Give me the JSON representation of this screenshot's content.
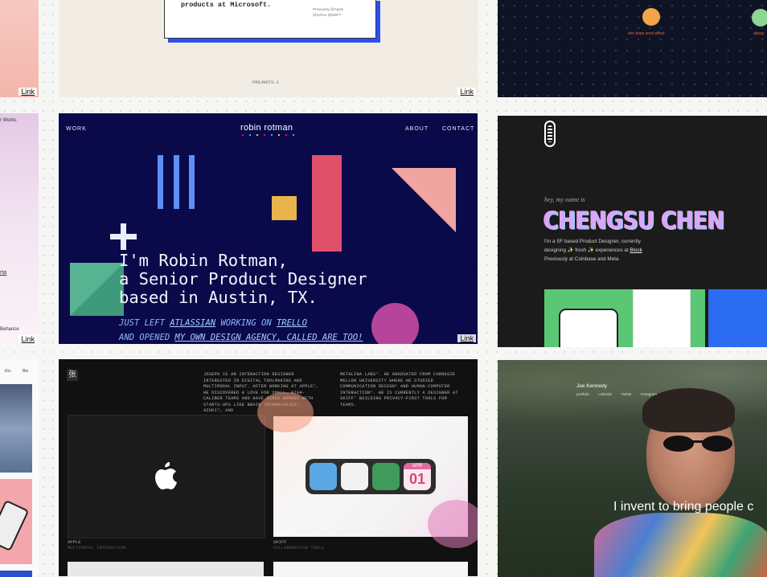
{
  "link_label": "Link",
  "top_middle": {
    "text": "products at Microsoft.",
    "meta_1": "Previously @Apple",
    "meta_2": "@Schoo @MSFT",
    "footer": "PROJNOTS-1"
  },
  "top_right": {
    "caption_1": "she bops wool effect",
    "caption_2": "ubsay"
  },
  "left_column": {
    "text_1": "r Works",
    "text_2": "rta",
    "text_3": "Behance",
    "nav_1": "Etc.",
    "nav_2": "Bio"
  },
  "robin": {
    "nav_work": "WORK",
    "logo": "robin rotman",
    "nav_about": "ABOUT",
    "nav_contact": "CONTACT",
    "headline": "I'm Robin Rotman,\na Senior Product Designer\nbased in Austin, TX.",
    "line1_a": "JUST LEFT ",
    "line1_link1": "ATLASSIAN",
    "line1_b": " WORKING ON ",
    "line1_link2": "TRELLO",
    "line2_a": "AND OPENED ",
    "line2_link": "MY OWN DESIGN AGENCY, CALLED ARE TOO!"
  },
  "cheng": {
    "greeting": "hey, my name is",
    "name": "CHENGSU CHEN",
    "bio_1": "I'm a SF based Product Designer, currently",
    "bio_2a": "designing ✨ fresh ✨ experiences at ",
    "bio_2b": "Block",
    "bio_3": "Previously at Coinbase and Meta."
  },
  "joseph": {
    "bio_left": "Joseph is an interaction designer interested in digital toolmaking and multimodal input. After working at Apple¹, he discovered a love for small, high-caliber teams and have since worked with starts-ups like Brain Technologies², Azuki³, and",
    "bio_right": "Metalina Labs⁴. He graduated from Carnegie Mellon University where he studied communication design⁵ and human-computer interaction⁶. He is currently a designer at Skiff⁷ building privacy-first tools for teams.",
    "project_1_title": "APPLE",
    "project_1_sub": "MULTIMODAL INTERACTION",
    "project_2_title": "SKIFF",
    "project_2_sub": "COLLABORATION TOOLS",
    "calendar_month": "APR",
    "calendar_day": "01"
  },
  "joe": {
    "name": "Joe Kennedy",
    "nav": [
      "portfolio",
      "LinkedIn",
      "Twitter",
      "Instagram"
    ],
    "tagline": "I invent to bring people c"
  }
}
